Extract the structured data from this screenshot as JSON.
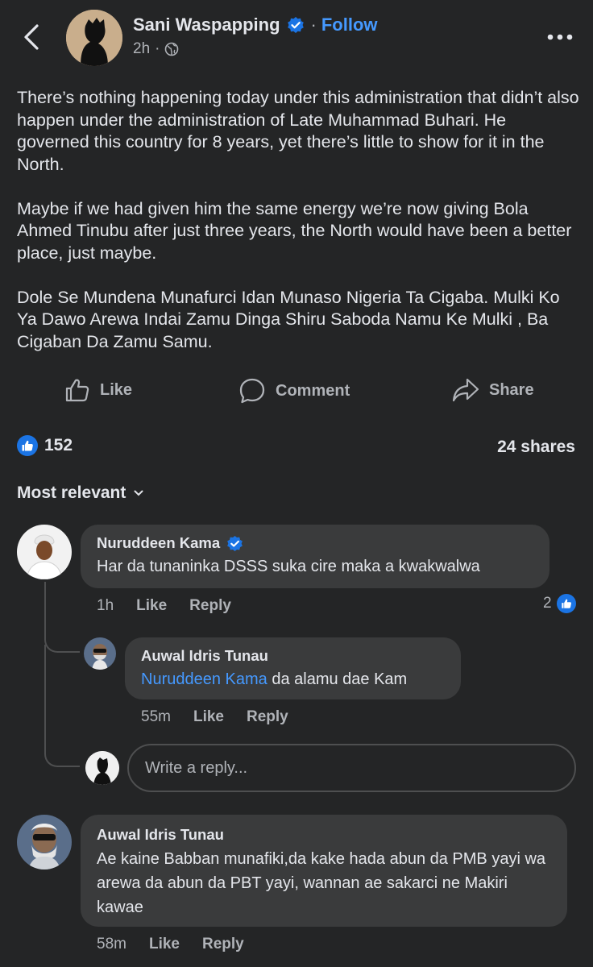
{
  "post": {
    "author": "Sani Waspapping",
    "follow_label": "Follow",
    "time": "2h",
    "paragraphs": [
      "There’s nothing happening today under this administration that didn’t also happen under the administration of Late Muhammad Buhari. He governed this country for 8 years, yet there’s little to show for it in the North.",
      "Maybe if we had given him the same energy we’re now giving Bola Ahmed Tinubu after just three years, the North would have been a better place, just maybe.",
      "Dole Se Mundena Munafurci Idan Munaso Nigeria Ta Cigaba. Mulki Ko Ya Dawo Arewa Indai Zamu Dinga Shiru Saboda Namu Ke Mulki , Ba Cigaban Da Zamu Samu."
    ],
    "actions": {
      "like": "Like",
      "comment": "Comment",
      "share": "Share"
    },
    "reactions_count": "152",
    "shares": "24 shares"
  },
  "comments_sort": "Most relevant",
  "comments": [
    {
      "name": "Nuruddeen Kama",
      "text": "Har da tunaninka DSSS suka cire maka a kwakwalwa",
      "time": "1h",
      "like": "Like",
      "reply": "Reply",
      "reactions": "2"
    },
    {
      "name": "Auwal Idris Tunau",
      "mention": "Nuruddeen Kama",
      "text": " da alamu dae Kam",
      "time": "55m",
      "like": "Like",
      "reply": "Reply"
    },
    {
      "name": "Auwal Idris Tunau",
      "text": "Ae kaine Babban munafiki,da kake hada abun da PMB yayi wa arewa da abun da PBT yayi, wannan ae sakarci ne Makiri kawae",
      "time": "58m",
      "like": "Like",
      "reply": "Reply"
    }
  ],
  "reply_placeholder": "Write a reply...",
  "colors": {
    "background": "#242526",
    "bubble": "#3a3b3c",
    "accent": "#4599ff",
    "like_blue": "#1b74e4"
  },
  "icons": [
    "back-arrow-icon",
    "verified-badge-icon",
    "globe-icon",
    "more-icon",
    "like-icon",
    "comment-icon",
    "share-icon",
    "chevron-down-icon"
  ]
}
